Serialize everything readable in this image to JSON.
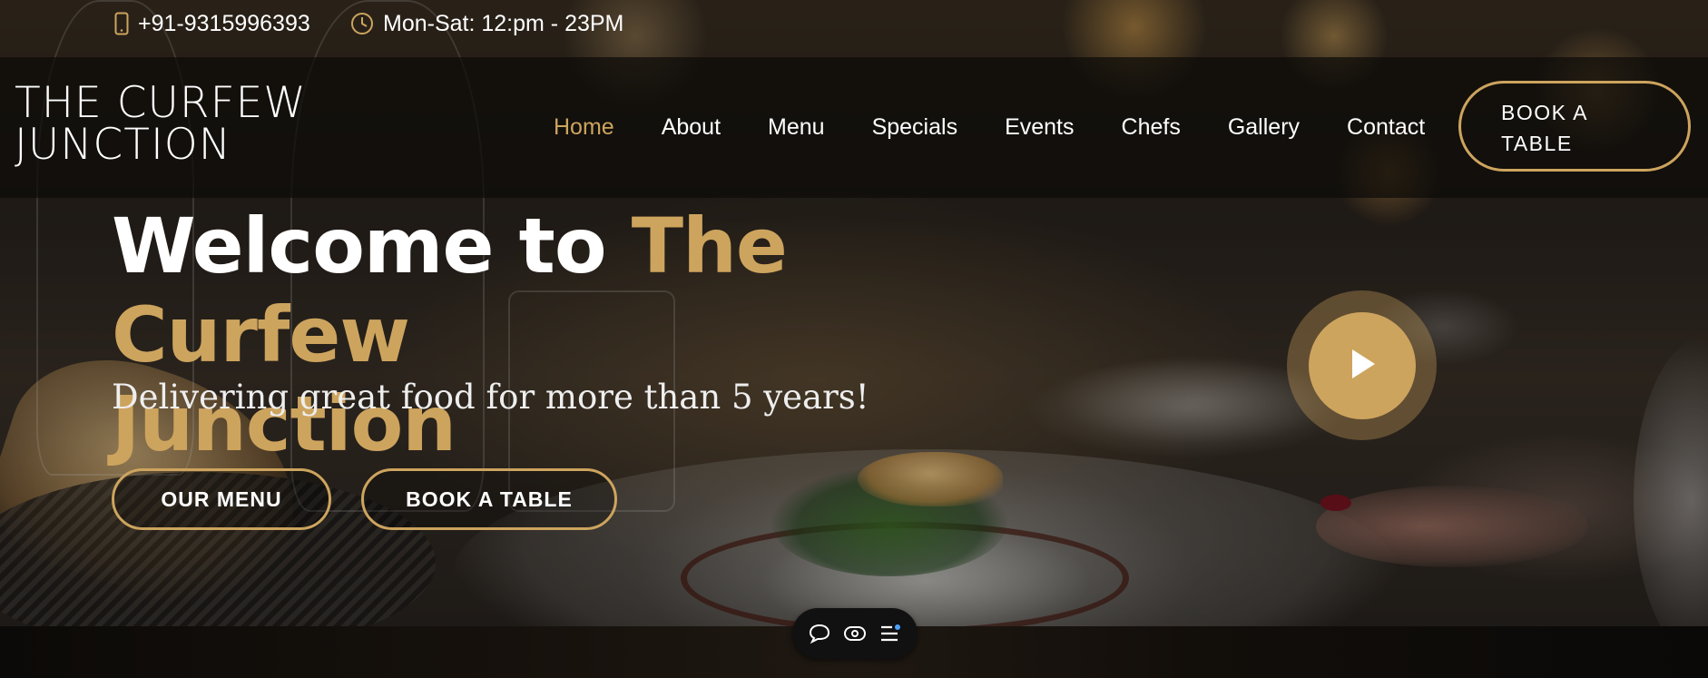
{
  "topbar": {
    "phone": "+91-9315996393",
    "phone_icon": "phone-icon",
    "hours": "Mon-Sat: 12:pm - 23PM",
    "hours_icon": "clock-icon"
  },
  "header": {
    "logo_line1": "THE CURFEW",
    "logo_line2": "JUNCTION",
    "nav": [
      {
        "label": "Home",
        "active": true
      },
      {
        "label": "About"
      },
      {
        "label": "Menu"
      },
      {
        "label": "Specials"
      },
      {
        "label": "Events"
      },
      {
        "label": "Chefs"
      },
      {
        "label": "Gallery"
      },
      {
        "label": "Contact"
      }
    ],
    "book_line1": "BOOK A",
    "book_line2": "TABLE"
  },
  "hero": {
    "headline_white": "Welcome to ",
    "headline_gold_1": "The Curfew",
    "headline_gold_2": "Junction",
    "tagline": "Delivering great food for more than 5 years!",
    "btn_menu": "OUR MENU",
    "btn_book": "BOOK A TABLE",
    "play_icon": "play-icon"
  },
  "floating_toolbar": {
    "icons": [
      "chat-bubble-icon",
      "eye-icon",
      "menu-list-icon"
    ]
  },
  "colors": {
    "accent": "#cda45e",
    "header_bg": "#0c0b09",
    "text": "#ffffff"
  }
}
